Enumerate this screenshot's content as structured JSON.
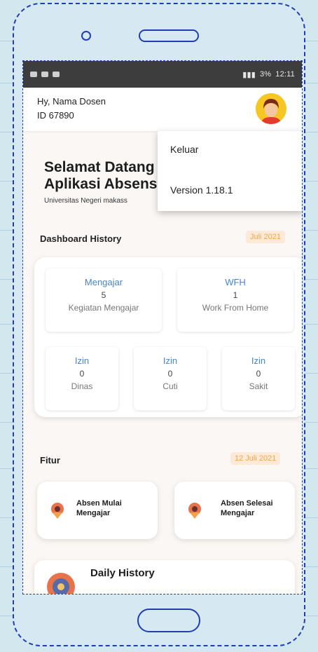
{
  "header": {
    "greeting": "Hy, Nama Dosen",
    "user_id": "ID 67890"
  },
  "menu": {
    "items": [
      {
        "label": "Keluar"
      },
      {
        "label": "Version 1.18.1"
      }
    ]
  },
  "welcome": {
    "line1": "Selamat Datang",
    "line2": "Aplikasi Absens",
    "university": "Universitas Negeri makass"
  },
  "dashboard": {
    "title": "Dashboard History",
    "date": "Juli 2021",
    "stats": [
      {
        "title": "Mengajar",
        "value": "5",
        "desc": "Kegiatan Mengajar"
      },
      {
        "title": "WFH",
        "value": "1",
        "desc": "Work From Home"
      },
      {
        "title": "Izin",
        "value": "0",
        "desc": "Dinas"
      },
      {
        "title": "Izin",
        "value": "0",
        "desc": "Cuti"
      },
      {
        "title": "Izin",
        "value": "0",
        "desc": "Sakit"
      }
    ]
  },
  "features": {
    "title": "Fitur",
    "date": "12 Juli 2021",
    "items": [
      {
        "label_line1": "Absen Mulai",
        "label_line2": "Mengajar"
      },
      {
        "label_line1": "Absen Selesai",
        "label_line2": "Mengajar"
      }
    ],
    "daily": "Daily History"
  },
  "status": {
    "time": "12:11",
    "battery": "3%"
  },
  "colors": {
    "accent_blue": "#4a86c5",
    "date_orange": "#f0a64b",
    "avatar_yellow": "#f6c623",
    "frame_blue": "#1f3fb0"
  }
}
